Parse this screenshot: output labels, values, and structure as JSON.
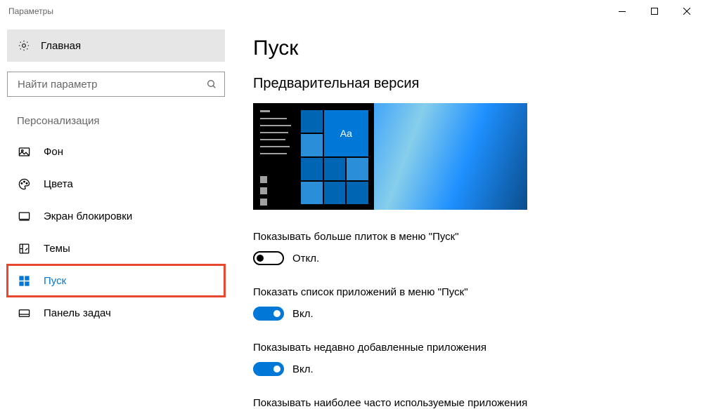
{
  "window": {
    "title": "Параметры"
  },
  "sidebar": {
    "home": "Главная",
    "search_placeholder": "Найти параметр",
    "section": "Персонализация",
    "items": [
      {
        "label": "Фон"
      },
      {
        "label": "Цвета"
      },
      {
        "label": "Экран блокировки"
      },
      {
        "label": "Темы"
      },
      {
        "label": "Пуск"
      },
      {
        "label": "Панель задач"
      }
    ]
  },
  "main": {
    "title": "Пуск",
    "subtitle": "Предварительная версия",
    "preview_tile_text": "Aa",
    "settings": [
      {
        "label": "Показывать больше плиток в меню \"Пуск\"",
        "on": false,
        "state": "Откл."
      },
      {
        "label": "Показать список приложений в меню \"Пуск\"",
        "on": true,
        "state": "Вкл."
      },
      {
        "label": "Показывать недавно добавленные приложения",
        "on": true,
        "state": "Вкл."
      },
      {
        "label": "Показывать наиболее часто используемые приложения",
        "on": null,
        "state": ""
      }
    ]
  }
}
